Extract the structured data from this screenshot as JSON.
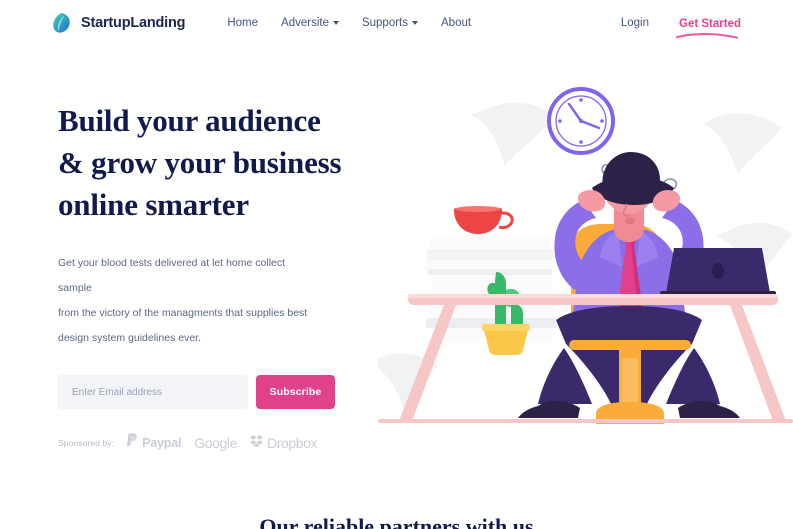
{
  "navbar": {
    "brand": {
      "name": "StartupLanding",
      "logo_icon": "leaf-logo-icon",
      "colors": [
        "#2bb9a0",
        "#1f6fd0"
      ]
    },
    "links": [
      {
        "label": "Home",
        "has_dropdown": false
      },
      {
        "label": "Adversite",
        "has_dropdown": true
      },
      {
        "label": "Supports",
        "has_dropdown": true
      },
      {
        "label": "About",
        "has_dropdown": false
      }
    ],
    "login_label": "Login",
    "cta_label": "Get Started",
    "cta_color": "#e83e8c"
  },
  "hero": {
    "headline_line1": "Build your audience",
    "headline_line2": "& grow your business",
    "headline_line3": "online smarter",
    "headline_color": "#101a4d",
    "paragraph_line1": "Get your blood tests delivered at let home collect sample",
    "paragraph_line2": "from the victory of the managments that supplies best",
    "paragraph_line3": "design system guidelines ever.",
    "email_placeholder": "Enter Email address",
    "email_value": "",
    "subscribe_label": "Subscribe",
    "subscribe_color": "#e0418a"
  },
  "sponsors": {
    "label": "Sponsored by:",
    "items": [
      {
        "name": "Paypal",
        "icon": "paypal-icon"
      },
      {
        "name": "Google",
        "icon": "google-wordmark-icon"
      },
      {
        "name": "Dropbox",
        "icon": "dropbox-icon"
      }
    ]
  },
  "illustration": {
    "name": "stressed-office-worker-illustration",
    "elements": [
      "wall-clock",
      "floating-papers",
      "coffee-cup",
      "book-stack",
      "cactus-plant",
      "person-hands-on-head",
      "office-chair",
      "laptop",
      "desk"
    ],
    "colors": {
      "clock": "#8263f0",
      "cup": "#ef4444",
      "desk": "#f7c6c6",
      "chair": "#fbab3a",
      "shirt": "#8c6fe8",
      "tie": "#e0418a",
      "pants": "#3b2a6b",
      "laptop": "#3b2a6b",
      "cactus": "#3ab86a",
      "pot": "#fbc84a",
      "paper": "#f1f2f4"
    }
  },
  "bottom": {
    "heading": "Our reliable partners with us"
  }
}
